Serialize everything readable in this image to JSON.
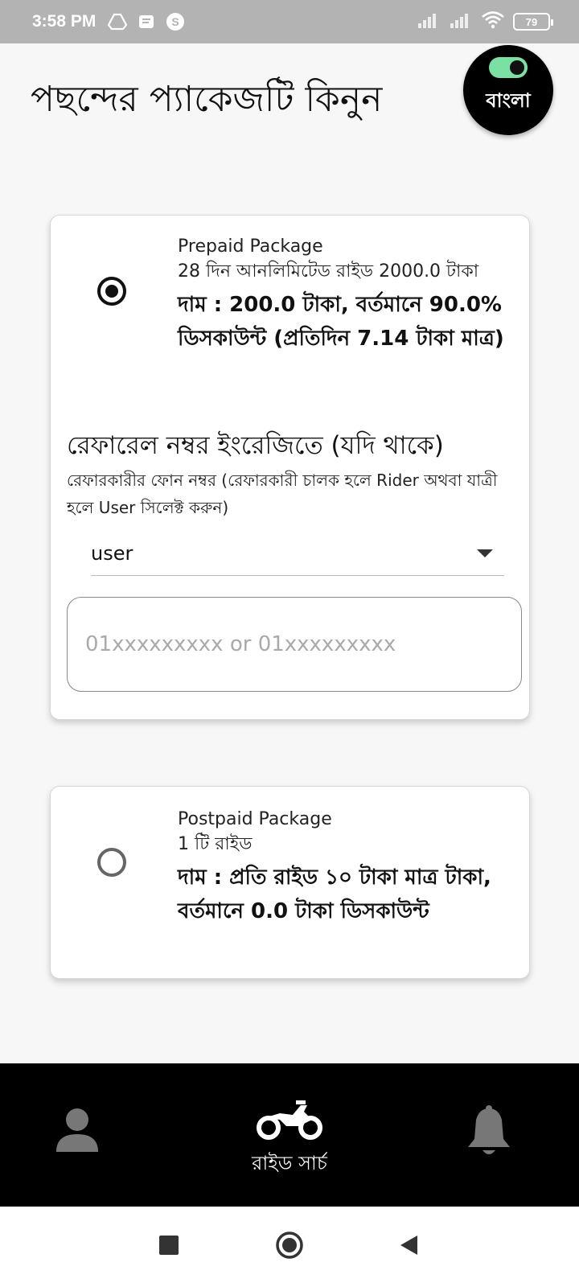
{
  "status_bar": {
    "time": "3:58 PM",
    "battery": "79"
  },
  "header": {
    "title": "পছন্দের প্যাকেজটি কিনুন",
    "language_label": "বাংলা"
  },
  "packages": [
    {
      "name": "Prepaid Package",
      "description": "28 দিন আনলিমিটেড রাইড 2000.0 টাকা",
      "price": "দাম : 200.0 টাকা, বর্তমানে 90.0% ডিসকাউন্ট (প্রতিদিন 7.14 টাকা মাত্র)",
      "selected": true
    },
    {
      "name": "Postpaid Package",
      "description": "1 টি রাইড",
      "price": "দাম : প্রতি রাইড ১০ টাকা মাত্র টাকা, বর্তমানে 0.0 টাকা ডিসকাউন্ট",
      "selected": false
    }
  ],
  "referral": {
    "title": "রেফারেল নম্বর ইংরেজিতে (যদি থাকে)",
    "hint": "রেফারকারীর ফোন নম্বর (রেফারকারী চালক হলে Rider অথবা যাত্রী হলে User সিলেক্ট করুন)",
    "dropdown_value": "user",
    "phone_placeholder": "01xxxxxxxxx or 01xxxxxxxxx",
    "phone_value": ""
  },
  "bottom_nav": {
    "ride_search_label": "রাইড সার্চ"
  },
  "icons": {
    "profile": "person-icon",
    "ride": "motorbike-icon",
    "notifications": "bell-icon"
  },
  "colors": {
    "status_bar": "#b3b3b3",
    "nav_bg": "#000000",
    "toggle_on": "#7be0a4"
  }
}
